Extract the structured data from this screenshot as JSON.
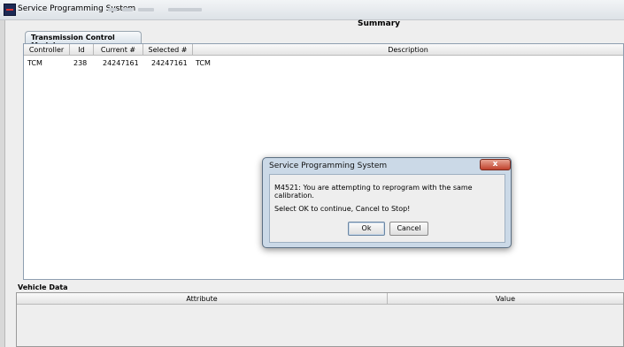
{
  "window": {
    "title": "Service Programming System"
  },
  "summary": {
    "title": "Summary"
  },
  "tabs": [
    {
      "label": "Transmission Control Module",
      "selected": true
    }
  ],
  "modules_table": {
    "columns": [
      "Controller",
      "Id",
      "Current #",
      "Selected #",
      "Description"
    ],
    "rows": [
      {
        "controller": "TCM",
        "id": "238",
        "current": "24247161",
        "selected": "24247161",
        "description": "TCM"
      }
    ]
  },
  "vehicle_data": {
    "title": "Vehicle Data",
    "columns": [
      "Attribute",
      "Value"
    ]
  },
  "dialog": {
    "title": "Service Programming System",
    "message_line1": "M4521: You are attempting to reprogram with the same calibration.",
    "message_line2": "Select OK to continue, Cancel to Stop!",
    "ok_label": "Ok",
    "cancel_label": "Cancel",
    "close_glyph": "x"
  },
  "colors": {
    "dialog_frame": "#cbd9e7",
    "close_button": "#c0412c",
    "panel_border": "#8e9eb0"
  }
}
